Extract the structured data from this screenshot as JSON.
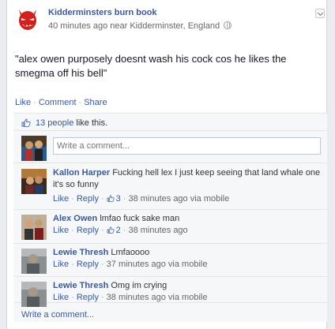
{
  "post": {
    "page_name": "Kidderminsters burn book",
    "meta": "40 minutes ago near Kidderminster, England",
    "text": "\"alex owen purposely doesnt wash his cock cos he likes the smegma off his bell\"",
    "actions": {
      "like": "Like",
      "comment": "Comment",
      "share": "Share"
    }
  },
  "feedback": {
    "likes_count": "13 people",
    "likes_suffix": "like this.",
    "composer_placeholder": "Write a comment...",
    "footer_link": "Write a comment..."
  },
  "comments": [
    {
      "author": "Kallon Harper",
      "text": "Fucking hell lex I just keep seeing that land whale one it's so funny",
      "like": "Like",
      "reply": "Reply",
      "likes": "3",
      "time": "38 minutes ago via mobile"
    },
    {
      "author": "Alex Owen",
      "text": "lmfao fuck sake man",
      "like": "Like",
      "reply": "Reply",
      "likes": "2",
      "time": "38 minutes ago"
    },
    {
      "author": "Lewie Thresh",
      "text": "Lmfaoooo",
      "like": "Like",
      "reply": "Reply",
      "time": "37 minutes ago via mobile"
    },
    {
      "author": "Lewie Thresh",
      "text": "Omg im crying",
      "like": "Like",
      "reply": "Reply",
      "time": "38 minutes ago via mobile"
    }
  ],
  "colors": {
    "link": "#3b5998",
    "page_bg": "#e9ebee",
    "feedback_bg": "#f6f7f8",
    "devil_red": "#d0211c"
  },
  "icons": {
    "avatar": "devil-face-icon",
    "privacy": "globe-icon",
    "menu": "chevron-down-icon",
    "like": "thumbs-up-icon"
  }
}
